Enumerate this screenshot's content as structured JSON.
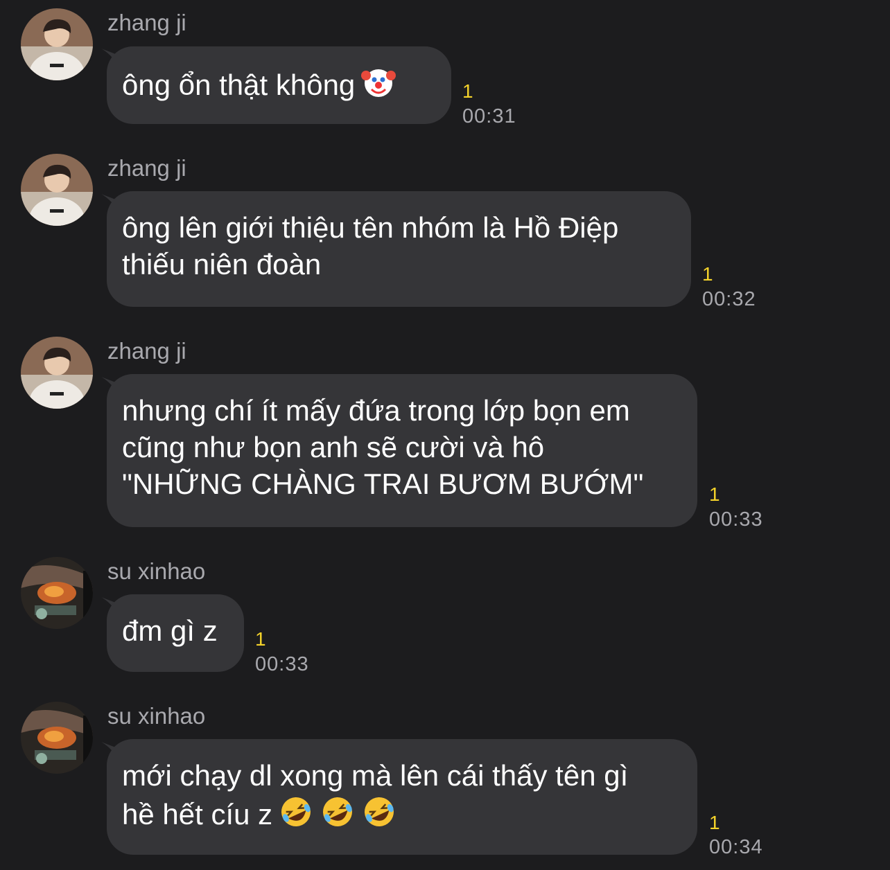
{
  "messages": [
    {
      "sender": "zhang ji",
      "avatar_icon": "user-photo-icon",
      "lines": [
        "ông ổn thật không"
      ],
      "trailing_emojis": [
        "clown-face-emoji"
      ],
      "unread": "1",
      "time": "00:31"
    },
    {
      "sender": "zhang ji",
      "avatar_icon": "user-photo-icon",
      "lines": [
        "ông lên giới thiệu tên nhóm là Hồ Điệp",
        "thiếu niên đoàn"
      ],
      "unread": "1",
      "time": "00:32"
    },
    {
      "sender": "zhang ji",
      "avatar_icon": "user-photo-icon",
      "lines": [
        "nhưng chí ít mấy đứa trong lớp bọn em",
        "cũng như bọn anh sẽ cười và hô",
        "\"NHỮNG CHÀNG TRAI BƯƠM BƯỚM\""
      ],
      "unread": "1",
      "time": "00:33"
    },
    {
      "sender": "su xinhao",
      "avatar_icon": "user-photo-icon",
      "lines": [
        "đm gì z"
      ],
      "unread": "1",
      "time": "00:33"
    },
    {
      "sender": "su xinhao",
      "avatar_icon": "user-photo-icon",
      "lines": [
        "mới chạy dl xong mà lên cái thấy tên gì",
        "hề hết cíu z"
      ],
      "trailing_emojis": [
        "rolling-laughing-emoji",
        "rolling-laughing-emoji",
        "rolling-laughing-emoji"
      ],
      "unread": "1",
      "time": "00:34"
    }
  ],
  "colors": {
    "background": "#1c1c1e",
    "bubble": "#353538",
    "text": "#ffffff",
    "meta": "#a9a9ae",
    "unread": "#f4d22a"
  }
}
